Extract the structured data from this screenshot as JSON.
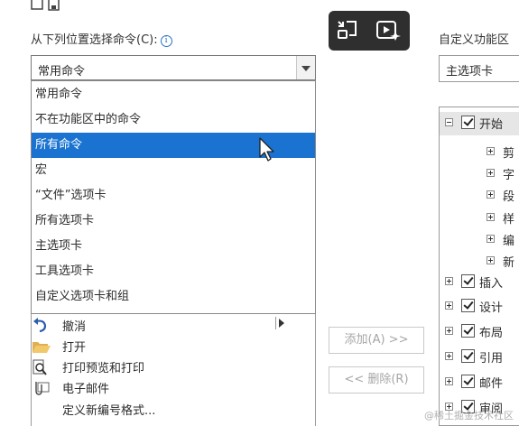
{
  "left": {
    "label": "从下列位置选择命令(C):",
    "info_glyph": "i",
    "combo_value": "常用命令",
    "dropdown_items": [
      {
        "label": "常用命令"
      },
      {
        "label": "不在功能区中的命令"
      },
      {
        "label": "所有命令"
      },
      {
        "label": "宏"
      },
      {
        "label": "“文件”选项卡"
      },
      {
        "label": "所有选项卡"
      },
      {
        "label": "主选项卡"
      },
      {
        "label": "工具选项卡"
      },
      {
        "label": "自定义选项卡和组"
      }
    ],
    "selected_index": 2,
    "commands": [
      {
        "label": "撤消",
        "icon": "undo-icon"
      },
      {
        "label": "打开",
        "icon": "folder-open-icon"
      },
      {
        "label": "打印预览和打印",
        "icon": "print-preview-icon"
      },
      {
        "label": "电子邮件",
        "icon": "email-attach-icon"
      },
      {
        "label": "定义新编号格式...",
        "icon": "numbering-icon"
      }
    ]
  },
  "middle": {
    "add_label": "添加(A) >>",
    "remove_label": "<< 删除(R)"
  },
  "right": {
    "label": "自定义功能区",
    "combo_value": "主选项卡",
    "tree": [
      {
        "label": "开始",
        "expanded": true,
        "checked": true
      },
      {
        "label": "剪",
        "child": true
      },
      {
        "label": "字",
        "child": true
      },
      {
        "label": "段",
        "child": true
      },
      {
        "label": "样",
        "child": true
      },
      {
        "label": "编",
        "child": true
      },
      {
        "label": "新",
        "child": true
      },
      {
        "label": "插入",
        "checked": true
      },
      {
        "label": "设计",
        "checked": true
      },
      {
        "label": "布局",
        "checked": true
      },
      {
        "label": "引用",
        "checked": true
      },
      {
        "label": "邮件",
        "checked": true
      },
      {
        "label": "审阅",
        "checked": true
      }
    ]
  },
  "watermark": "@稀土掘金技术社区",
  "colors": {
    "selection": "#1a73d1",
    "overlay": "#2f2f2f",
    "info": "#2a73c4"
  }
}
